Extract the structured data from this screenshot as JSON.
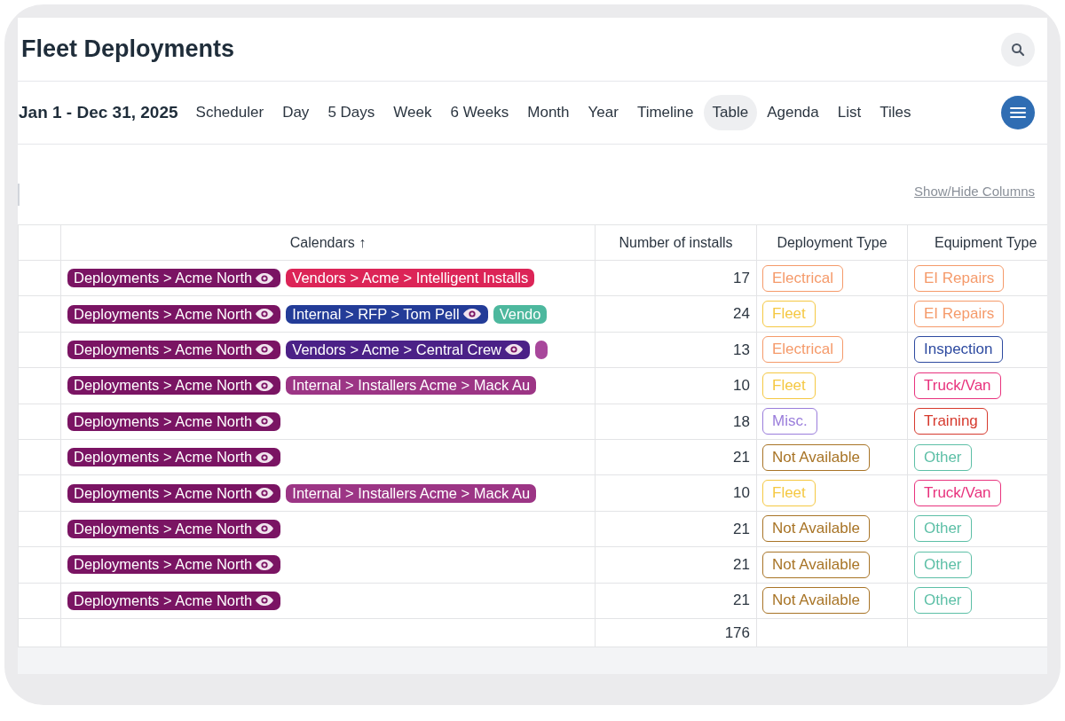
{
  "title": "Fleet Deployments",
  "date_range": "Jan 1 - Dec 31, 2025",
  "views": [
    {
      "label": "Scheduler",
      "selected": false
    },
    {
      "label": "Day",
      "selected": false
    },
    {
      "label": "5 Days",
      "selected": false
    },
    {
      "label": "Week",
      "selected": false
    },
    {
      "label": "6 Weeks",
      "selected": false
    },
    {
      "label": "Month",
      "selected": false
    },
    {
      "label": "Year",
      "selected": false
    },
    {
      "label": "Timeline",
      "selected": false
    },
    {
      "label": "Table",
      "selected": true
    },
    {
      "label": "Agenda",
      "selected": false
    },
    {
      "label": "List",
      "selected": false
    },
    {
      "label": "Tiles",
      "selected": false
    }
  ],
  "show_hide_link": "Show/Hide Columns",
  "table": {
    "columns": [
      "Calendars ↑",
      "Number of installs",
      "Deployment Type",
      "Equipment Type"
    ],
    "rows": [
      {
        "calendars": [
          {
            "label": "Deployments > Acme North",
            "color": "#7a1463",
            "eye": true
          },
          {
            "label": "Vendors > Acme > Intelligent Installs",
            "color": "#dc2457",
            "eye": false
          }
        ],
        "installs": "17",
        "deployment_type": {
          "label": "Electrical",
          "color": "#f59a6a"
        },
        "equipment_type": {
          "label": "EI Repairs",
          "color": "#f59a6a"
        }
      },
      {
        "calendars": [
          {
            "label": "Deployments > Acme North",
            "color": "#7a1463",
            "eye": true
          },
          {
            "label": "Internal > RFP > Tom Pell",
            "color": "#233c98",
            "eye": true
          },
          {
            "label": "Vendo",
            "color": "#4db89e",
            "eye": false
          }
        ],
        "installs": "24",
        "deployment_type": {
          "label": "Fleet",
          "color": "#f5c842"
        },
        "equipment_type": {
          "label": "EI Repairs",
          "color": "#f59a6a"
        }
      },
      {
        "calendars": [
          {
            "label": "Deployments > Acme North",
            "color": "#7a1463",
            "eye": true
          },
          {
            "label": "Vendors > Acme > Central Crew",
            "color": "#4b2187",
            "eye": true
          },
          {
            "color": "#a8479b",
            "eye": false
          }
        ],
        "installs": "13",
        "deployment_type": {
          "label": "Electrical",
          "color": "#f59a6a"
        },
        "equipment_type": {
          "label": "Inspection",
          "color": "#2d4aa0"
        }
      },
      {
        "calendars": [
          {
            "label": "Deployments > Acme North",
            "color": "#7a1463",
            "eye": true
          },
          {
            "label": "Internal > Installers Acme > Mack Au",
            "color": "#9c3585",
            "eye": false
          }
        ],
        "installs": "10",
        "deployment_type": {
          "label": "Fleet",
          "color": "#f5c842"
        },
        "equipment_type": {
          "label": "Truck/Van",
          "color": "#e8327d"
        }
      },
      {
        "calendars": [
          {
            "label": "Deployments > Acme North",
            "color": "#7a1463",
            "eye": true
          }
        ],
        "installs": "18",
        "deployment_type": {
          "label": "Misc.",
          "color": "#9a7ddb"
        },
        "equipment_type": {
          "label": "Training",
          "color": "#d63a2e"
        }
      },
      {
        "calendars": [
          {
            "label": "Deployments > Acme North",
            "color": "#7a1463",
            "eye": true
          }
        ],
        "installs": "21",
        "deployment_type": {
          "label": "Not Available",
          "color": "#a87426"
        },
        "equipment_type": {
          "label": "Other",
          "color": "#5cbfa6"
        }
      },
      {
        "calendars": [
          {
            "label": "Deployments > Acme North",
            "color": "#7a1463",
            "eye": true
          },
          {
            "label": "Internal > Installers Acme > Mack Au",
            "color": "#9c3585",
            "eye": false
          }
        ],
        "installs": "10",
        "deployment_type": {
          "label": "Fleet",
          "color": "#f5c842"
        },
        "equipment_type": {
          "label": "Truck/Van",
          "color": "#e8327d"
        }
      },
      {
        "calendars": [
          {
            "label": "Deployments > Acme North",
            "color": "#7a1463",
            "eye": true
          }
        ],
        "installs": "21",
        "deployment_type": {
          "label": "Not Available",
          "color": "#a87426"
        },
        "equipment_type": {
          "label": "Other",
          "color": "#5cbfa6"
        }
      },
      {
        "calendars": [
          {
            "label": "Deployments > Acme North",
            "color": "#7a1463",
            "eye": true
          }
        ],
        "installs": "21",
        "deployment_type": {
          "label": "Not Available",
          "color": "#a87426"
        },
        "equipment_type": {
          "label": "Other",
          "color": "#5cbfa6"
        }
      },
      {
        "calendars": [
          {
            "label": "Deployments > Acme North",
            "color": "#7a1463",
            "eye": true
          }
        ],
        "installs": "21",
        "deployment_type": {
          "label": "Not Available",
          "color": "#a87426"
        },
        "equipment_type": {
          "label": "Other",
          "color": "#5cbfa6"
        }
      }
    ],
    "total_installs": "176"
  }
}
